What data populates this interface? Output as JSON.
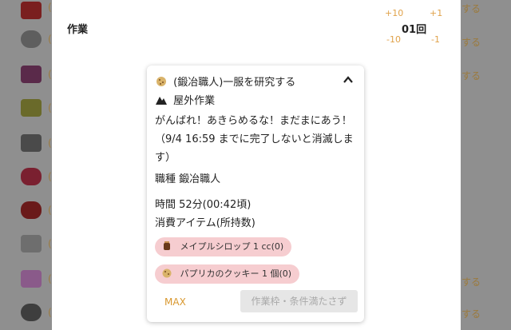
{
  "background": {
    "left_paren": "(",
    "right_text": "する"
  },
  "panel": {
    "title": "作業",
    "steps": {
      "plus_ten": "+10",
      "plus_one": "+1",
      "minus_ten": "-10",
      "minus_one": "-1"
    },
    "count": "01回"
  },
  "card": {
    "title": "(鍛冶職人)一服を研究する",
    "location": "屋外作業",
    "message": "がんばれ！あきらめるな！まだまにあう！（9/4 16:59 までに完了しないと消滅します）",
    "job": "職種 鍛冶職人",
    "time": "時間 52分(00:42頃)",
    "consumed_label": "消費アイテム(所持数)",
    "items": [
      {
        "icon": "syrup-jar-icon",
        "label": "メイプルシロップ 1 cc(0)"
      },
      {
        "icon": "cookie-icon",
        "label": "パプリカのクッキー 1 個(0)"
      }
    ],
    "max_label": "MAX",
    "submit_label": "作業枠・条件満たさず"
  },
  "colors": {
    "accent": "#e0a24a",
    "pill": "#f6cdd0",
    "overlay": "#8f8f8f"
  }
}
